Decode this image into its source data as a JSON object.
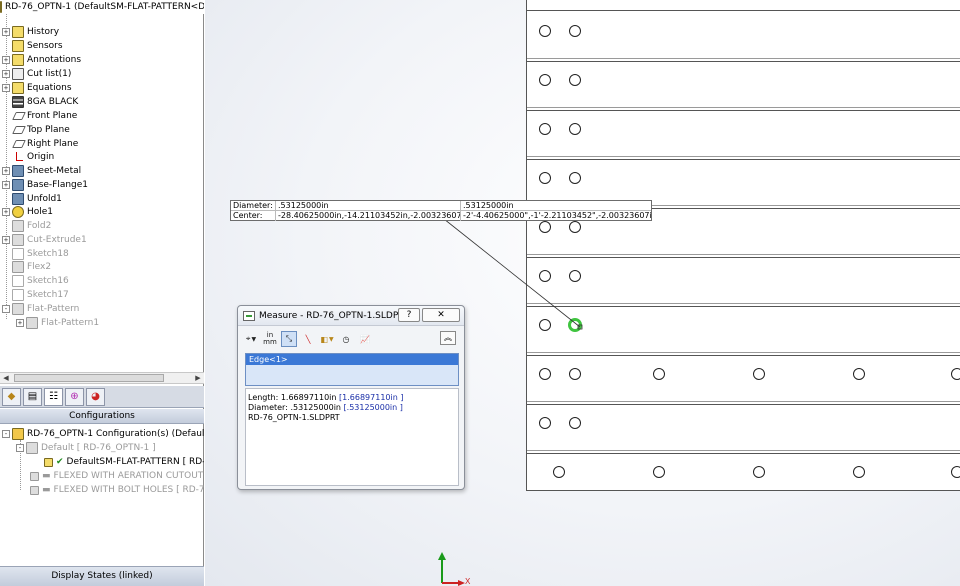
{
  "tree": {
    "root": "RD-76_OPTN-1  (DefaultSM-FLAT-PATTERN<D",
    "items": [
      {
        "label": "History",
        "expander": "+"
      },
      {
        "label": "Sensors",
        "expander": ""
      },
      {
        "label": "Annotations",
        "expander": "+"
      },
      {
        "label": "Cut list(1)",
        "expander": "+"
      },
      {
        "label": "Equations",
        "expander": "+"
      },
      {
        "label": "8GA BLACK",
        "expander": ""
      },
      {
        "label": "Front Plane",
        "expander": ""
      },
      {
        "label": "Top Plane",
        "expander": ""
      },
      {
        "label": "Right Plane",
        "expander": ""
      },
      {
        "label": "Origin",
        "expander": ""
      },
      {
        "label": "Sheet-Metal",
        "expander": "+"
      },
      {
        "label": "Base-Flange1",
        "expander": "+"
      },
      {
        "label": "Unfold1",
        "expander": ""
      },
      {
        "label": "Hole1",
        "expander": "+"
      },
      {
        "label": "Fold2",
        "expander": ""
      },
      {
        "label": "Cut-Extrude1",
        "expander": "+"
      },
      {
        "label": "Sketch18",
        "expander": ""
      },
      {
        "label": "Flex2",
        "expander": ""
      },
      {
        "label": "Sketch16",
        "expander": ""
      },
      {
        "label": "Sketch17",
        "expander": ""
      },
      {
        "label": "Flat-Pattern",
        "expander": "-"
      },
      {
        "label": "Flat-Pattern1",
        "expander": "+"
      }
    ]
  },
  "config": {
    "header": "Configurations",
    "root": "RD-76_OPTN-1 Configuration(s)  (DefaultSI",
    "items": [
      {
        "label": "Default [ RD-76_OPTN-1 ]"
      },
      {
        "label": "DefaultSM-FLAT-PATTERN [ RD-"
      },
      {
        "label": "FLEXED WITH AERATION CUTOUT ["
      },
      {
        "label": "FLEXED WITH BOLT HOLES [ RD-76_"
      }
    ],
    "footer": "Display States (linked)"
  },
  "tip": {
    "row1_label": "Diameter:",
    "row1_value": ".53125000in",
    "row1_value2": ".53125000in",
    "row2_label": "Center:",
    "row2_value": "-28.40625000in,-14.21103452in,-2.00323607in",
    "row2_value2": "-2'-4.40625000\",-1'-2.21103452\",-2.00323607in"
  },
  "dialog": {
    "title": "Measure - RD-76_OPTN-1.SLDPRT",
    "help": "?",
    "units_in": "in",
    "units_mm": "mm",
    "selection": "Edge<1>",
    "length_label": "Length: 1.66897110in",
    "length_alt": "[1.66897110in ]",
    "diameter_label": "Diameter: .53125000in",
    "diameter_alt": "[.53125000in ]",
    "filename": "RD-76_OPTN-1.SLDPRT"
  },
  "triad": {
    "x_label": "X"
  }
}
